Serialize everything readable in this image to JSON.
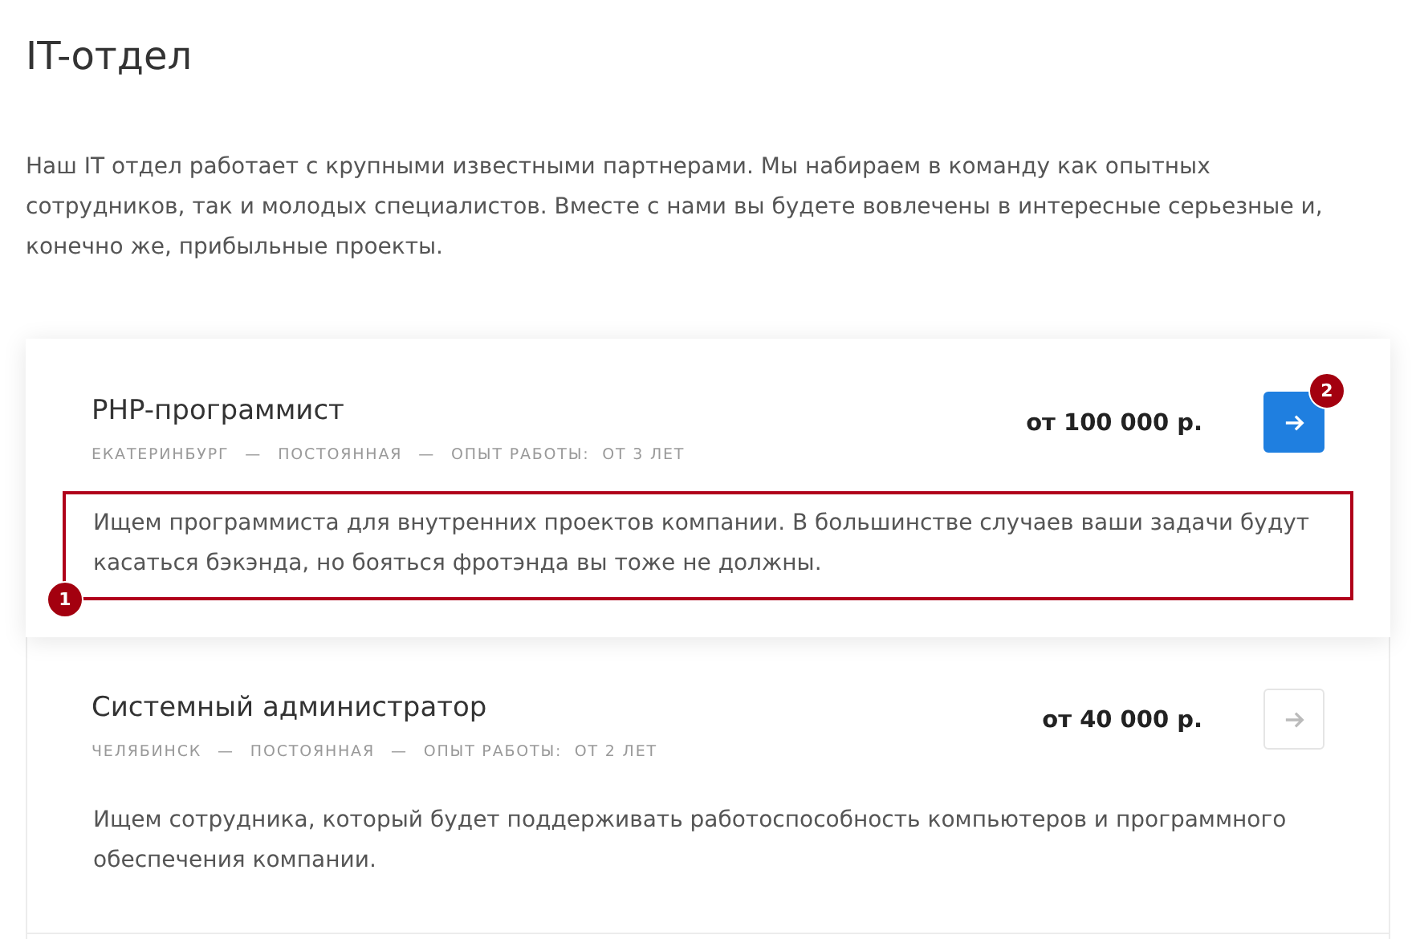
{
  "heading": "IT-отдел",
  "intro": "Наш IT отдел работает с крупными известными партнерами. Мы набираем в команду как опытных сотрудников, так и молодых специалистов. Вместе с нами вы будете вовлечены в интересные серьезные и, конечно же, прибыльные проекты.",
  "jobs": [
    {
      "title": "PHP-программист",
      "meta": [
        "ЕКАТЕРИНБУРГ",
        "ПОСТОЯННАЯ",
        "ОПЫТ РАБОТЫ:  ОТ 3 ЛЕТ"
      ],
      "separator": "—",
      "salary": "от 100 000 р.",
      "active": true,
      "button_badge": "2",
      "description": "Ищем программиста для внутренних проектов компании. В большинстве случаев ваши задачи будут касаться бэкэнда, но бояться фротэнда вы тоже не должны.",
      "highlight_badge": "1"
    },
    {
      "title": "Системный администратор",
      "meta": [
        "ЧЕЛЯБИНСК",
        "ПОСТОЯННАЯ",
        "ОПЫТ РАБОТЫ:  ОТ 2 ЛЕТ"
      ],
      "separator": "—",
      "salary": "от 40 000 р.",
      "active": false,
      "description": "Ищем сотрудника, который будет поддерживать работоспособность компьютеров и программного обеспечения компании."
    }
  ]
}
